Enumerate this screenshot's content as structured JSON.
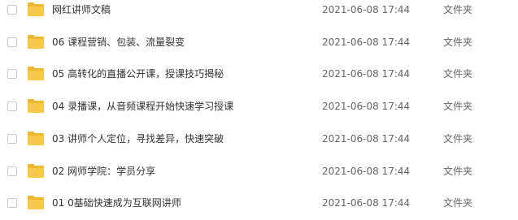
{
  "files": [
    {
      "name": "网红讲师文稿",
      "date": "2021-06-08 17:44",
      "type": "文件夹",
      "icon": "folder-icon"
    },
    {
      "name": "06 课程营销、包装、流量裂变",
      "date": "2021-06-08 17:44",
      "type": "文件夹",
      "icon": "folder-icon"
    },
    {
      "name": "05 高转化的直播公开课，授课技巧揭秘",
      "date": "2021-06-08 17:44",
      "type": "文件夹",
      "icon": "folder-icon"
    },
    {
      "name": "04 录播课，从音频课程开始快速学习授课",
      "date": "2021-06-08 17:44",
      "type": "文件夹",
      "icon": "folder-icon"
    },
    {
      "name": "03 讲师个人定位，寻找差异，快速突破",
      "date": "2021-06-08 17:44",
      "type": "文件夹",
      "icon": "folder-icon"
    },
    {
      "name": "02 网师学院：学员分享",
      "date": "2021-06-08 17:44",
      "type": "文件夹",
      "icon": "folder-icon"
    },
    {
      "name": "01 0基础快速成为互联网讲师",
      "date": "2021-06-08 17:44",
      "type": "文件夹",
      "icon": "folder-icon"
    }
  ],
  "colors": {
    "folder": "#f7c948",
    "folder_dark": "#efb82e"
  }
}
